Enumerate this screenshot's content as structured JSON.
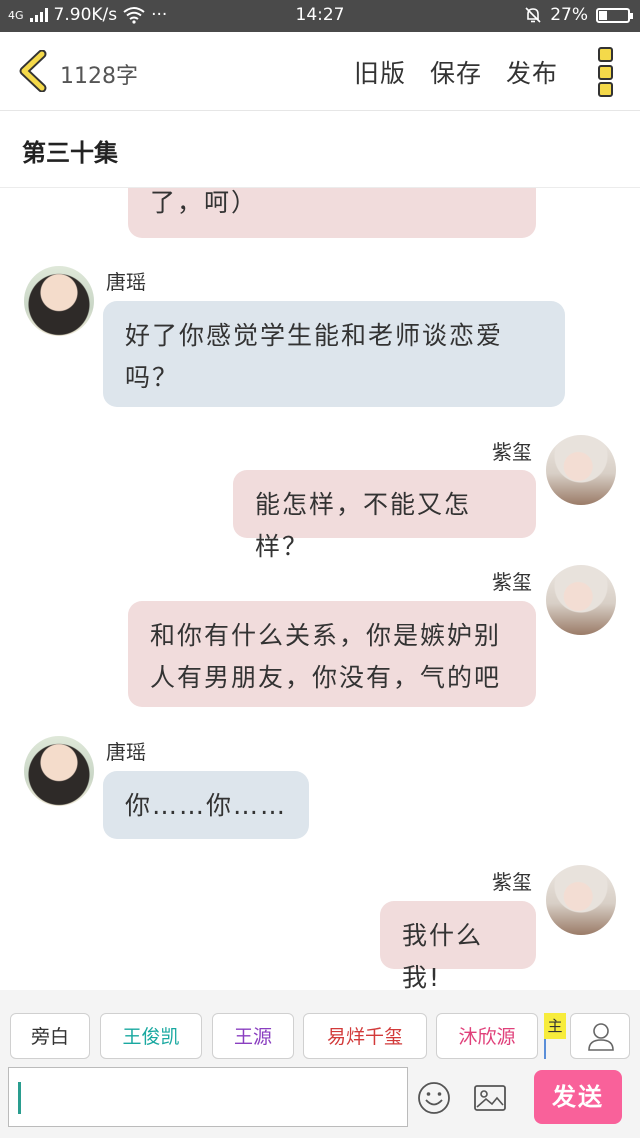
{
  "status_bar": {
    "network": "4G",
    "speed": "7.90K/s",
    "more": "···",
    "time": "14:27",
    "battery": "27%",
    "battery_level": 0.27
  },
  "header": {
    "word_count": "1128字",
    "actions": [
      "旧版",
      "保存",
      "发布"
    ]
  },
  "episode": {
    "title": "第三十集"
  },
  "messages": [
    {
      "side": "right",
      "sender": "",
      "text": "了，呵）",
      "bubble": "pink",
      "partial": true
    },
    {
      "side": "left",
      "sender": "唐瑶",
      "text": "好了你感觉学生能和老师谈恋爱吗？",
      "bubble": "blue"
    },
    {
      "side": "right",
      "sender": "紫玺",
      "text": "能怎样，不能又怎样？",
      "bubble": "pink"
    },
    {
      "side": "right",
      "sender": "紫玺",
      "text": "和你有什么关系，你是嫉妒别人有男朋友，你没有，气的吧",
      "bubble": "pink"
    },
    {
      "side": "left",
      "sender": "唐瑶",
      "text": "你……你……",
      "bubble": "blue"
    },
    {
      "side": "right",
      "sender": "紫玺",
      "text": "我什么我!",
      "bubble": "pink"
    }
  ],
  "roles": [
    {
      "label": "旁白",
      "color": "#333333"
    },
    {
      "label": "王俊凯",
      "color": "#19a8a0"
    },
    {
      "label": "王源",
      "color": "#8a3fc0"
    },
    {
      "label": "易烊千玺",
      "color": "#d23a3a"
    },
    {
      "label": "沐欣源",
      "color": "#e0407a"
    }
  ],
  "protagonist_tag": "主",
  "input": {
    "value": "",
    "placeholder": ""
  },
  "send_label": "发送",
  "colors": {
    "pink_bubble": "#f1dcdc",
    "blue_bubble": "#dde5ec",
    "send_button": "#f9619a",
    "status_bar": "#4a4a4a"
  }
}
